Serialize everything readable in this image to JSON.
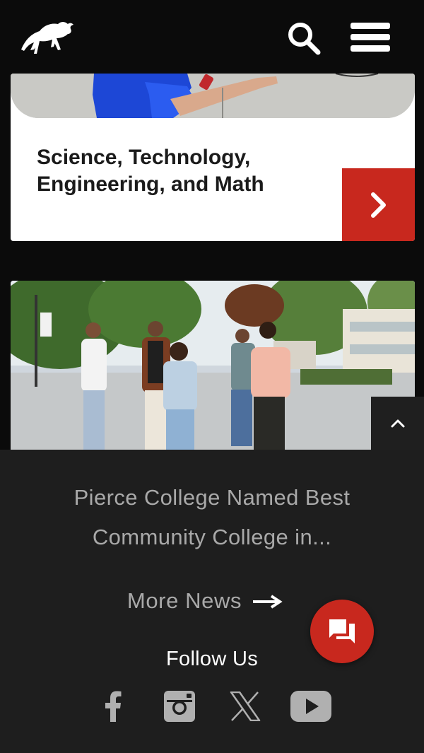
{
  "header": {
    "logo_icon": "buffalo-logo-icon",
    "search_icon": "search-icon",
    "menu_icon": "hamburger-menu-icon"
  },
  "program_card": {
    "title": "Science, Technology, Engineering, and Math",
    "arrow_icon": "chevron-right-icon",
    "accent_color": "#c8281e"
  },
  "news": {
    "headline": "Pierce College Named Best Community College in...",
    "more_label": "More News",
    "more_icon": "arrow-right-icon"
  },
  "back_to_top_icon": "chevron-up-icon",
  "follow": {
    "title": "Follow Us",
    "networks": [
      "facebook-icon",
      "instagram-icon",
      "x-icon",
      "youtube-icon"
    ]
  },
  "chat_icon": "chat-icon",
  "colors": {
    "background": "#0b0b0b",
    "panel": "#1e1e1e",
    "muted_text": "#a9a9a9",
    "accent": "#c8281e"
  }
}
